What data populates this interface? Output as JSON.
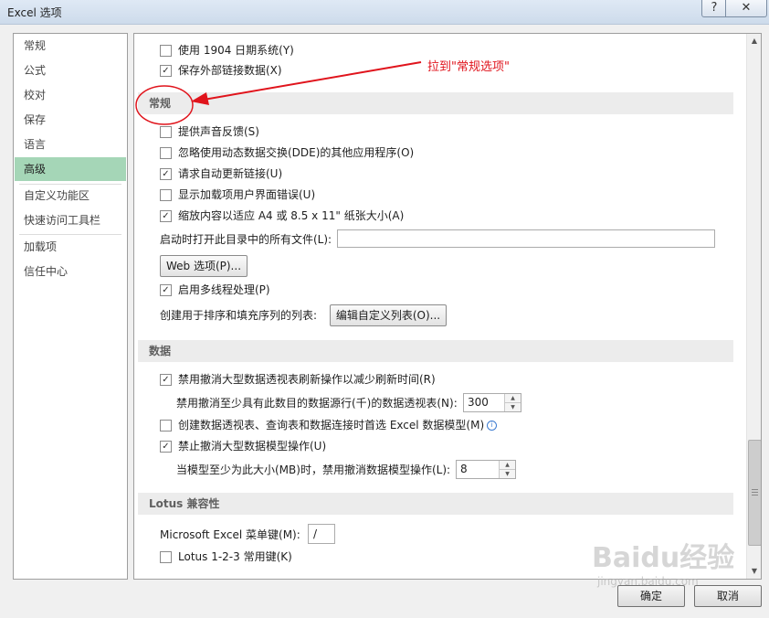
{
  "window": {
    "title": "Excel 选项",
    "help_label": "?",
    "close_label": "✕"
  },
  "sidebar": {
    "items": [
      {
        "label": "常规"
      },
      {
        "label": "公式"
      },
      {
        "label": "校对"
      },
      {
        "label": "保存"
      },
      {
        "label": "语言"
      },
      {
        "label": "高级"
      },
      {
        "label": "自定义功能区"
      },
      {
        "label": "快速访问工具栏"
      },
      {
        "label": "加载项"
      },
      {
        "label": "信任中心"
      }
    ],
    "selected": "高级"
  },
  "top_options": {
    "use_1904": {
      "label": "使用 1904 日期系统(Y)",
      "checked": false
    },
    "save_external": {
      "label": "保存外部链接数据(X)",
      "checked": true
    }
  },
  "annotation": {
    "text": "拉到\"常规选项\"",
    "color": "#e0141c"
  },
  "general": {
    "header": "常规",
    "sound_feedback": {
      "label": "提供声音反馈(S)",
      "checked": false
    },
    "ignore_dde": {
      "label": "忽略使用动态数据交换(DDE)的其他应用程序(O)",
      "checked": false
    },
    "ask_update_links": {
      "label": "请求自动更新链接(U)",
      "checked": true
    },
    "show_addin_errors": {
      "label": "显示加载项用户界面错误(U)",
      "checked": false
    },
    "scale_a4": {
      "label": "缩放内容以适应 A4 或 8.5 x 11\" 纸张大小(A)",
      "checked": true
    },
    "startup_folder": {
      "label": "启动时打开此目录中的所有文件(L):",
      "value": ""
    },
    "web_options_button": "Web 选项(P)...",
    "multithread": {
      "label": "启用多线程处理(P)",
      "checked": true
    },
    "custom_lists_label": "创建用于排序和填充序列的列表:",
    "edit_custom_lists_button": "编辑自定义列表(O)..."
  },
  "data_section": {
    "header": "数据",
    "disable_undo_pivot": {
      "label": "禁用撤消大型数据透视表刷新操作以减少刷新时间(R)",
      "checked": true
    },
    "pivot_rows_label": "禁用撤消至少具有此数目的数据源行(千)的数据透视表(N):",
    "pivot_rows_value": "300",
    "prefer_data_model": {
      "label": "创建数据透视表、查询表和数据连接时首选 Excel 数据模型(M)",
      "checked": false
    },
    "info_icon": "ⓘ",
    "disable_undo_model": {
      "label": "禁止撤消大型数据模型操作(U)",
      "checked": true
    },
    "model_size_label": "当模型至少为此大小(MB)时，禁用撤消数据模型操作(L):",
    "model_size_value": "8"
  },
  "lotus": {
    "header": "Lotus 兼容性",
    "menu_key_label": "Microsoft Excel 菜单键(M):",
    "menu_key_value": "/",
    "lotus_keys": {
      "label": "Lotus 1-2-3 常用键(K)",
      "checked": false
    }
  },
  "footer": {
    "ok_label": "确定",
    "cancel_label": "取消"
  },
  "watermark": {
    "main": "Baidu经验",
    "sub": "jingyan.baidu.com"
  },
  "glyphs": {
    "check": "✓",
    "up": "▲",
    "down": "▼"
  }
}
